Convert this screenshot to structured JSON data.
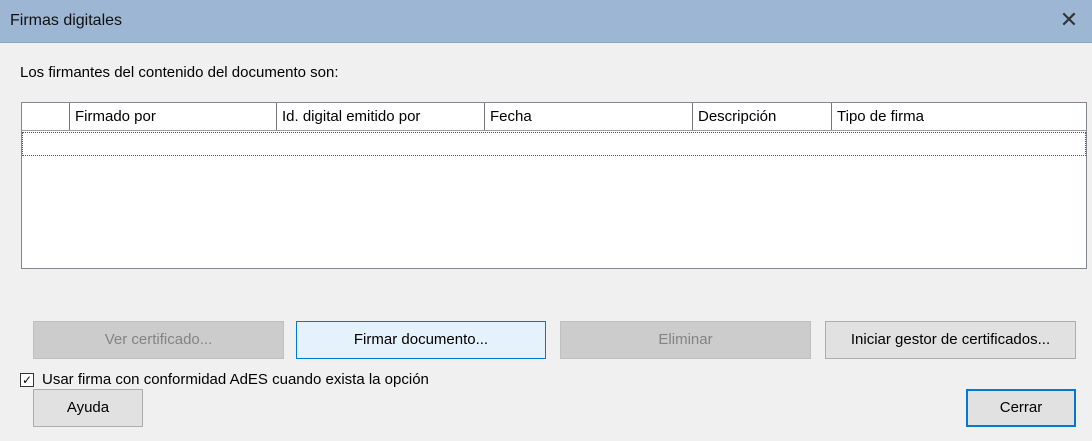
{
  "window": {
    "title": "Firmas digitales",
    "close_symbol": "✕"
  },
  "intro": "Los firmantes del contenido del documento son:",
  "table": {
    "columns": [
      "",
      "Firmado por",
      "Id. digital emitido por",
      "Fecha",
      "Descripción",
      "Tipo de firma"
    ],
    "rows": []
  },
  "ades_option": {
    "label": "Usar firma con conformidad AdES cuando exista la opción",
    "checked": true,
    "check_glyph": "✓"
  },
  "buttons": {
    "view_cert": "Ver certificado...",
    "sign": "Firmar documento...",
    "remove": "Eliminar",
    "cert_manager": "Iniciar gestor de certificados...",
    "help": "Ayuda",
    "close": "Cerrar"
  }
}
